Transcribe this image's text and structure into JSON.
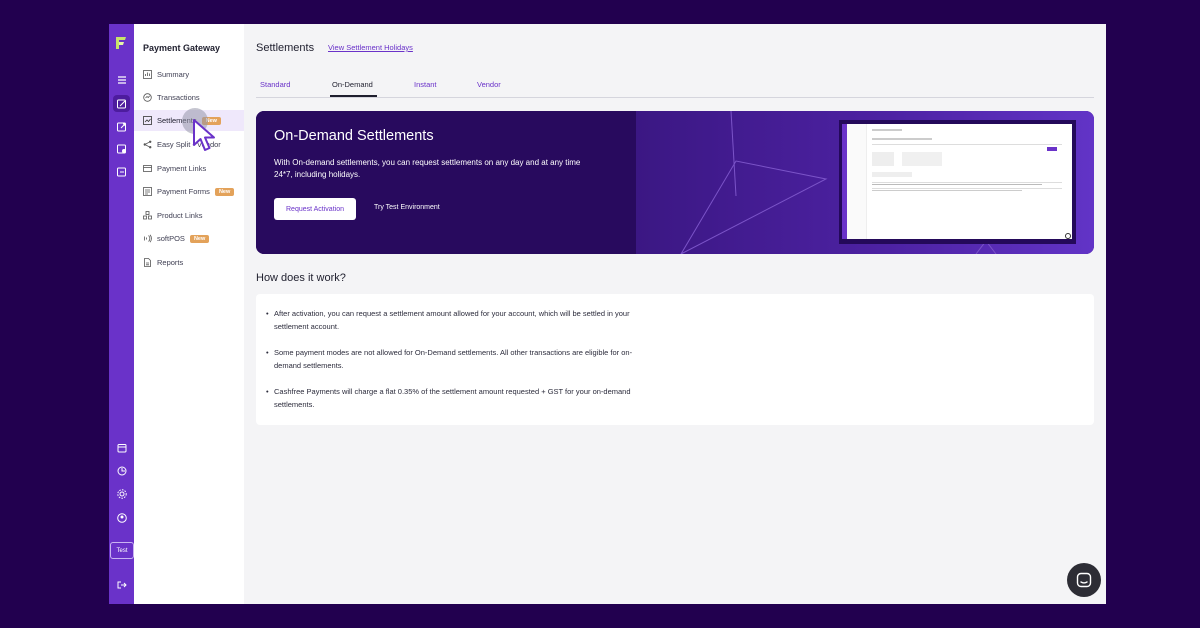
{
  "colors": {
    "brand": "#6a32c9",
    "background": "#22004f",
    "badge": "#e3a25a"
  },
  "sidebar": {
    "title": "Payment Gateway",
    "items": [
      {
        "label": "Summary",
        "icon": "summary-icon",
        "badge": ""
      },
      {
        "label": "Transactions",
        "icon": "transactions-icon",
        "badge": ""
      },
      {
        "label": "Settlements",
        "icon": "settlements-icon",
        "badge": "New"
      },
      {
        "label": "Easy Split - Vendor",
        "icon": "split-icon",
        "badge": ""
      },
      {
        "label": "Payment Links",
        "icon": "link-icon",
        "badge": ""
      },
      {
        "label": "Payment Forms",
        "icon": "form-icon",
        "badge": "New"
      },
      {
        "label": "Product Links",
        "icon": "product-icon",
        "badge": ""
      },
      {
        "label": "softPOS",
        "icon": "softpos-icon",
        "badge": "New"
      },
      {
        "label": "Reports",
        "icon": "report-icon",
        "badge": ""
      }
    ]
  },
  "rail": {
    "test_label": "Test"
  },
  "header": {
    "title": "Settlements",
    "link": "View Settlement Holidays"
  },
  "tabs": [
    "Standard",
    "On-Demand",
    "Instant",
    "Vendor"
  ],
  "banner": {
    "title": "On-Demand Settlements",
    "description": "With On-demand settlements, you can request settlements on any day and at any time 24*7, including holidays.",
    "primary_button": "Request Activation",
    "secondary_button": "Try Test Environment"
  },
  "how": {
    "title": "How does it work?",
    "points": [
      "After activation, you can request a settlement amount allowed for your account, which will be settled in your settlement account.",
      "Some payment modes are not allowed for On-Demand settlements. All other transactions are eligible for on-demand settlements.",
      "Cashfree Payments will charge a flat 0.35% of the settlement amount requested + GST for your on-demand settlements."
    ]
  }
}
